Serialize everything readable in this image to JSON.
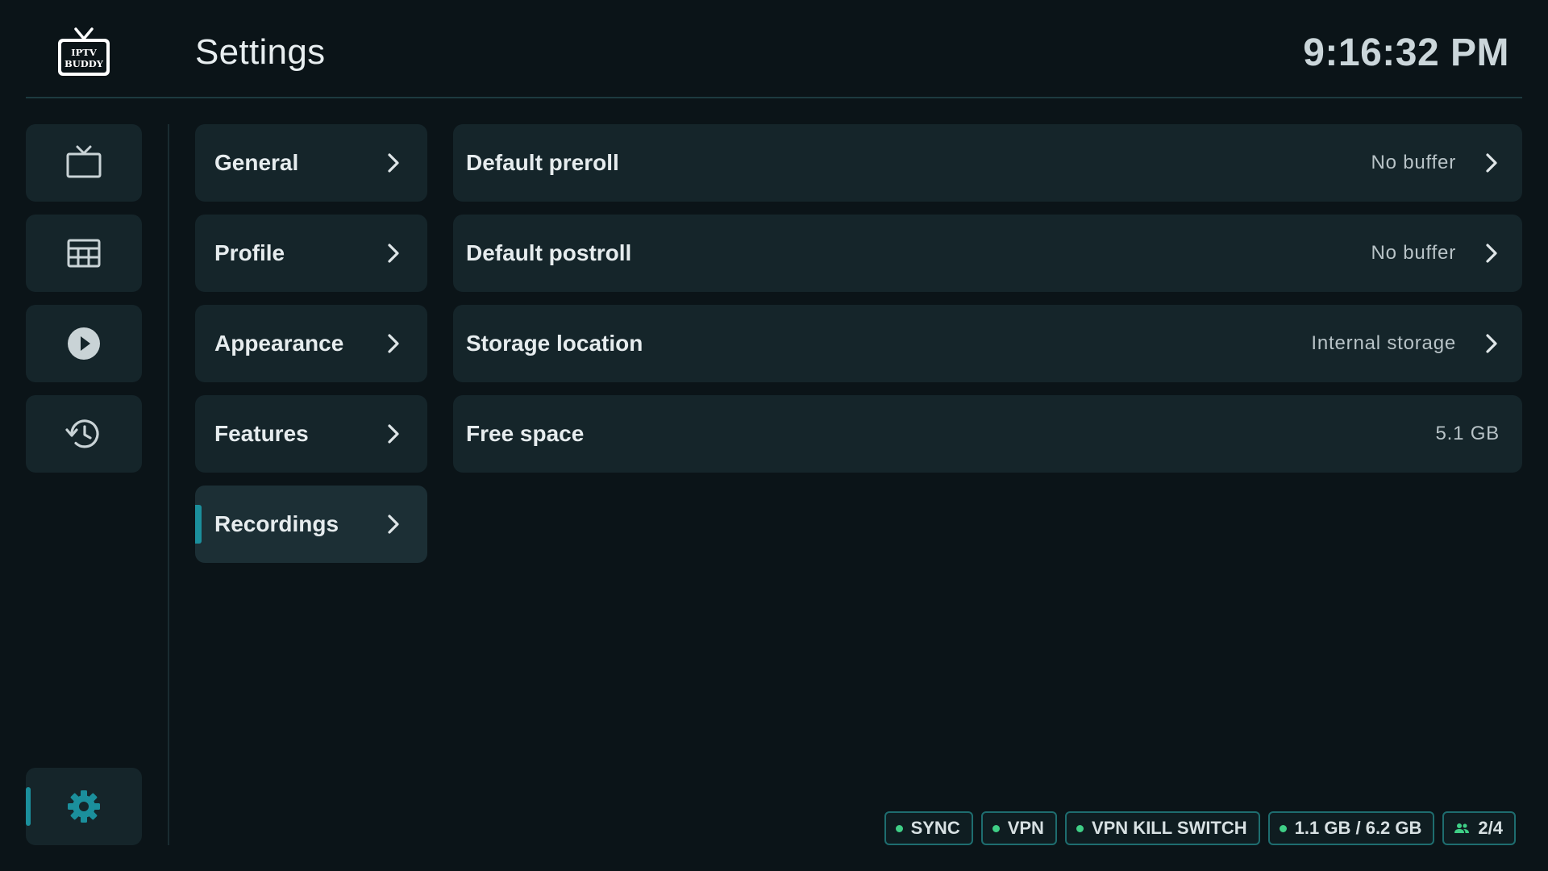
{
  "header": {
    "logo_text": [
      "IPTV",
      "BUDDY"
    ],
    "title": "Settings",
    "clock": "9:16:32 PM"
  },
  "rail": [
    {
      "id": "live-tv",
      "icon": "tv-icon",
      "active": false
    },
    {
      "id": "guide",
      "icon": "grid-icon",
      "active": false
    },
    {
      "id": "vod",
      "icon": "play-icon",
      "active": false
    },
    {
      "id": "history",
      "icon": "history-icon",
      "active": false
    },
    {
      "id": "settings",
      "icon": "gear-icon",
      "active": true
    }
  ],
  "categories": [
    {
      "label": "General",
      "selected": false
    },
    {
      "label": "Profile",
      "selected": false
    },
    {
      "label": "Appearance",
      "selected": false
    },
    {
      "label": "Features",
      "selected": false
    },
    {
      "label": "Recordings",
      "selected": true
    }
  ],
  "rows": [
    {
      "label": "Default preroll",
      "value": "No buffer",
      "chevron": true
    },
    {
      "label": "Default postroll",
      "value": "No buffer",
      "chevron": true
    },
    {
      "label": "Storage location",
      "value": "Internal storage",
      "chevron": true
    },
    {
      "label": "Free space",
      "value": "5.1 GB",
      "chevron": false
    }
  ],
  "status": [
    {
      "label": "SYNC",
      "icon": "status-dot"
    },
    {
      "label": "VPN",
      "icon": "status-dot"
    },
    {
      "label": "VPN KILL SWITCH",
      "icon": "status-dot"
    },
    {
      "label": "1.1 GB / 6.2 GB",
      "icon": "status-dot"
    },
    {
      "label": "2/4",
      "icon": "users-icon"
    }
  ],
  "colors": {
    "background": "#0b1418",
    "card": "#15252a",
    "accent": "#1b8f9c",
    "status_ok": "#3fcf86",
    "chip_border": "#1e6d6f"
  }
}
